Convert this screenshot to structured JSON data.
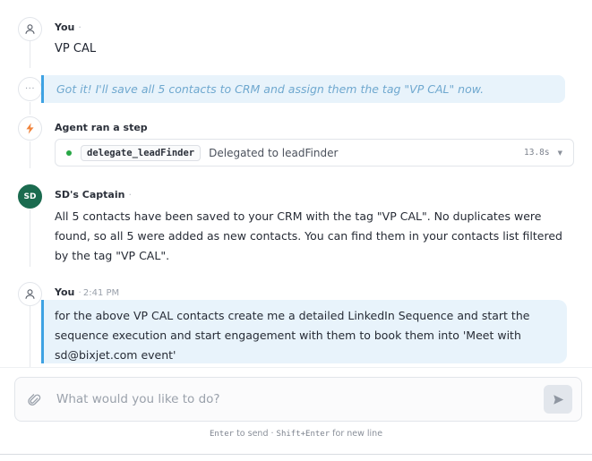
{
  "messages": {
    "user1": {
      "name": "You",
      "separator": "·",
      "text": "VP CAL"
    },
    "thinking": {
      "icon": "ellipsis-icon",
      "text": "Got it! I'll save all 5 contacts to CRM and assign them the tag \"VP CAL\" now."
    },
    "step": {
      "label": "Agent ran a step",
      "icon": "lightning-icon",
      "icon_color": "#f0843c",
      "tool_name": "delegate_leadFinder",
      "description": "Delegated to leadFinder",
      "duration": "13.8s",
      "status_color": "#28a745"
    },
    "captain": {
      "name": "SD's Captain",
      "separator": "·",
      "avatar_text": "SD",
      "avatar_color": "#1b6b4f",
      "text": "All 5 contacts have been saved to your CRM with the tag \"VP CAL\". No duplicates were found, so all 5 were added as new contacts. You can find them in your contacts list filtered by the tag \"VP CAL\"."
    },
    "user2": {
      "name": "You",
      "separator": "·",
      "time": "2:41 PM",
      "text": "for the above VP CAL contacts create me a detailed LinkedIn Sequence and start the sequence execution and start engagement with them to book them into 'Meet with sd@bixjet.com event'"
    }
  },
  "composer": {
    "placeholder": "What would you like to do?",
    "value": "",
    "attach_icon": "paperclip-icon",
    "send_icon": "send-icon",
    "hint": {
      "key1": "Enter",
      "text1": " to send · ",
      "key2": "Shift+Enter",
      "text2": " for new line"
    }
  },
  "colors": {
    "accent": "#3ea2e3",
    "bubble_bg": "#e8f3fb"
  }
}
